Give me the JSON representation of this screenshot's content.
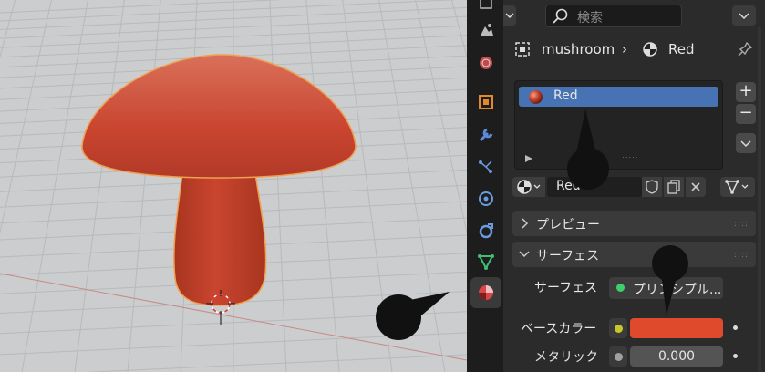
{
  "properties": {
    "search_placeholder": "検索",
    "breadcrumb": {
      "object": "mushroom",
      "separator": "›",
      "material": "Red"
    },
    "material_slots": [
      {
        "name": "Red",
        "selected": true
      }
    ],
    "material_name": "Red",
    "sections": {
      "preview": "プレビュー",
      "surface": "サーフェス"
    },
    "surface_row": {
      "label": "サーフェス",
      "value": "プリンシプル..."
    },
    "base_color": {
      "label": "ベースカラー",
      "color": "#e04a2c"
    },
    "metallic": {
      "label": "メタリック",
      "value": "0.000"
    }
  },
  "colors": {
    "mushroom": "#c9452f",
    "outline": "#f0a050",
    "selection": "#4772b3",
    "active_tab": "#d94646"
  },
  "tabs": [
    "view-layer-icon",
    "scene-icon",
    "world-icon",
    "object-icon",
    "modifier-icon",
    "particles-icon",
    "physics-icon",
    "constraints-icon",
    "data-icon",
    "material-icon"
  ]
}
